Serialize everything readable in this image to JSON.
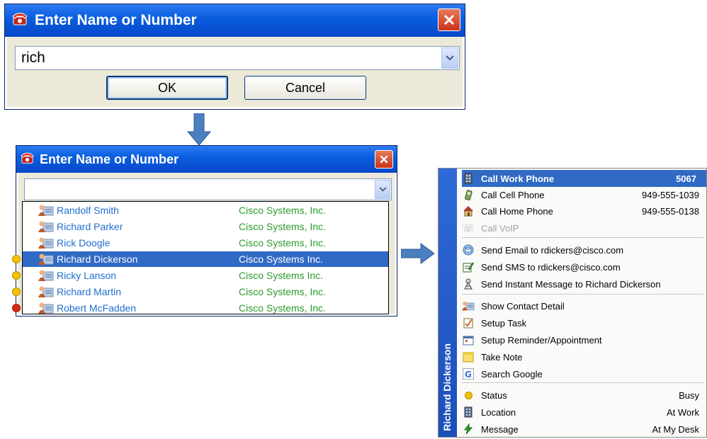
{
  "window1": {
    "title": "Enter Name or Number",
    "input_value": "rich",
    "ok_label": "OK",
    "cancel_label": "Cancel"
  },
  "window2": {
    "title": "Enter Name or Number",
    "input_value": "",
    "results": [
      {
        "name": "Randolf Smith",
        "company": "Cisco Systems, Inc.",
        "status": "none"
      },
      {
        "name": "Richard Parker",
        "company": "Cisco Systems, Inc.",
        "status": "none"
      },
      {
        "name": "Rick Doogle",
        "company": "Cisco Systems, Inc.",
        "status": "none"
      },
      {
        "name": "Richard Dickerson",
        "company": "Cisco Systems Inc.",
        "status": "busy"
      },
      {
        "name": "Ricky Lanson",
        "company": "Cisco Systems Inc.",
        "status": "busy"
      },
      {
        "name": "Richard Martin",
        "company": "Cisco Systems, Inc.",
        "status": "busy"
      },
      {
        "name": "Robert McFadden",
        "company": "Cisco Systems, Inc.",
        "status": "offline"
      }
    ],
    "selected_index": 3
  },
  "context_menu": {
    "contact_name": "Richard Dickerson",
    "groups": [
      [
        {
          "label": "Call Work Phone",
          "value": "5067",
          "icon": "building-icon",
          "selected": true
        },
        {
          "label": "Call Cell Phone",
          "value": "949-555-1039",
          "icon": "cell-phone-icon"
        },
        {
          "label": "Call Home Phone",
          "value": "949-555-0138",
          "icon": "home-icon"
        },
        {
          "label": "Call VoIP",
          "value": "",
          "icon": "voip-icon",
          "disabled": true
        }
      ],
      [
        {
          "label": "Send Email to rdickers@cisco.com",
          "value": "",
          "icon": "email-icon"
        },
        {
          "label": "Send SMS to rdickers@cisco.com",
          "value": "",
          "icon": "sms-icon"
        },
        {
          "label": "Send Instant Message to Richard Dickerson",
          "value": "",
          "icon": "instant-message-icon"
        }
      ],
      [
        {
          "label": "Show Contact Detail",
          "value": "",
          "icon": "contact-card-icon"
        },
        {
          "label": "Setup Task",
          "value": "",
          "icon": "task-icon"
        },
        {
          "label": "Setup Reminder/Appointment",
          "value": "",
          "icon": "calendar-icon"
        },
        {
          "label": "Take Note",
          "value": "",
          "icon": "note-icon"
        },
        {
          "label": "Search Google",
          "value": "",
          "icon": "google-icon"
        }
      ],
      [
        {
          "label": "Status",
          "value": "Busy",
          "icon": "status-dot-icon"
        },
        {
          "label": "Location",
          "value": "At Work",
          "icon": "building-icon"
        },
        {
          "label": "Message",
          "value": "At My Desk",
          "icon": "lightning-icon"
        }
      ]
    ]
  },
  "colors": {
    "title_blue": "#0a5fe0",
    "selection_blue": "#316ac5",
    "name_blue": "#1f6fd0",
    "company_green": "#2a9b2a",
    "busy_yellow": "#f2c200",
    "offline_red": "#d92a1a"
  }
}
